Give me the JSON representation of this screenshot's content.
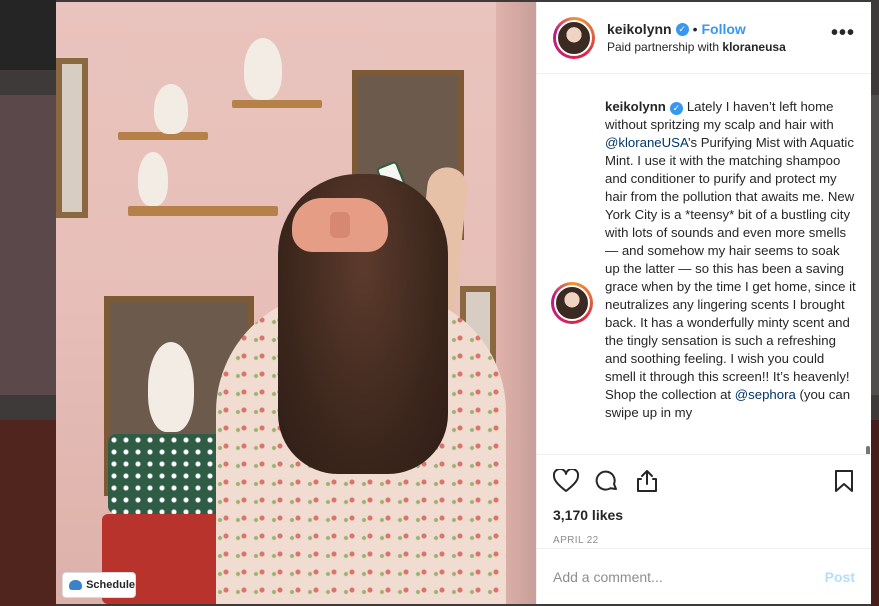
{
  "header": {
    "username": "keikolynn",
    "follow_label": "Follow",
    "separator": "•",
    "paid_prefix": "Paid partnership with",
    "partner": "kloraneusa",
    "more_label": "•••"
  },
  "caption": {
    "username": "keikolynn",
    "text_1": "Lately I haven’t left home without spritzing my scalp and hair with ",
    "mention_1": "@kloraneUSA",
    "text_2": "’s Purifying Mist with Aquatic Mint. I use it with the matching shampoo and conditioner to purify and protect my hair from the pollution that awaits me. New York City is a *teensy* bit of a bustling city with lots of sounds and even more smells — and somehow my hair seems to soak up the latter — so this has been a saving grace when by the time I get home, since it neutralizes any lingering scents I brought back. It has a wonderfully minty scent and the tingly sensation is such a refreshing and soothing feeling. I wish you could smell it through this screen!! It’s heavenly! Shop the collection at ",
    "mention_2": "@sephora",
    "text_3": " (you can swipe up in my"
  },
  "actions": {
    "icons": [
      "heart-icon",
      "comment-icon",
      "share-icon",
      "bookmark-icon"
    ],
    "likes": "3,170 likes",
    "date": "APRIL 22"
  },
  "comment": {
    "placeholder": "Add a comment...",
    "post_label": "Post"
  },
  "photo": {
    "schedule_label": "Schedule"
  },
  "colors": {
    "link": "#3897f0",
    "text": "#262626",
    "muted": "#8e8e8e",
    "post_disabled": "#b2dffc"
  }
}
